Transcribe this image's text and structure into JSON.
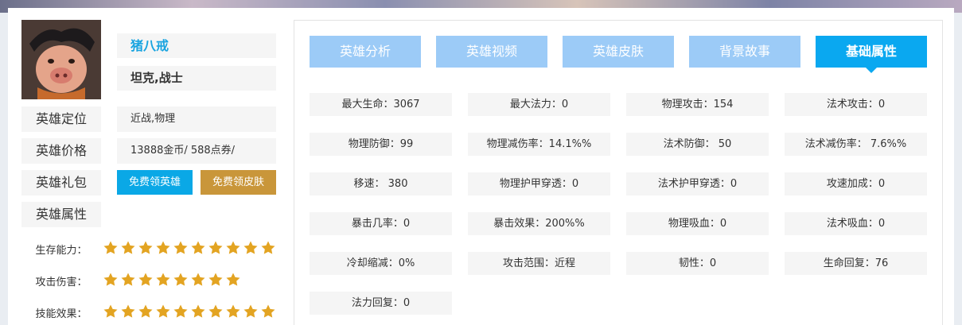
{
  "hero": {
    "name": "猪八戒",
    "class": "坦克,战士",
    "fields": [
      {
        "label": "英雄定位",
        "value": "近战,物理"
      },
      {
        "label": "英雄价格",
        "value": "13888金币/ 588点券/"
      },
      {
        "label": "英雄礼包"
      },
      {
        "label": "英雄属性"
      }
    ],
    "buttons": {
      "free_hero": "免费领英雄",
      "free_skin": "免费领皮肤"
    }
  },
  "ratings": [
    {
      "label": "生存能力：",
      "stars": 10
    },
    {
      "label": "攻击伤害：",
      "stars": 8
    },
    {
      "label": "技能效果：",
      "stars": 10
    }
  ],
  "colors": {
    "accent": "#0aa8f0",
    "tab_inactive": "#9ccbf7",
    "star": "#e3a422",
    "skin_button": "#c9963a"
  },
  "tabs": [
    {
      "label": "英雄分析",
      "active": false
    },
    {
      "label": "英雄视频",
      "active": false
    },
    {
      "label": "英雄皮肤",
      "active": false
    },
    {
      "label": "背景故事",
      "active": false
    },
    {
      "label": "基础属性",
      "active": true
    }
  ],
  "attributes": [
    "最大生命：3067",
    "最大法力：0",
    "物理攻击：154",
    "法术攻击：0",
    "物理防御：99",
    "物理减伤率：14.1%%",
    "法术防御： 50",
    "法术减伤率： 7.6%%",
    "移速： 380",
    "物理护甲穿透：0",
    "法术护甲穿透：0",
    "攻速加成：0",
    "暴击几率：0",
    "暴击效果：200%%",
    "物理吸血：0",
    "法术吸血：0",
    "冷却缩减：0%",
    "攻击范围：近程",
    "韧性：0",
    "生命回复：76",
    "法力回复：0"
  ]
}
